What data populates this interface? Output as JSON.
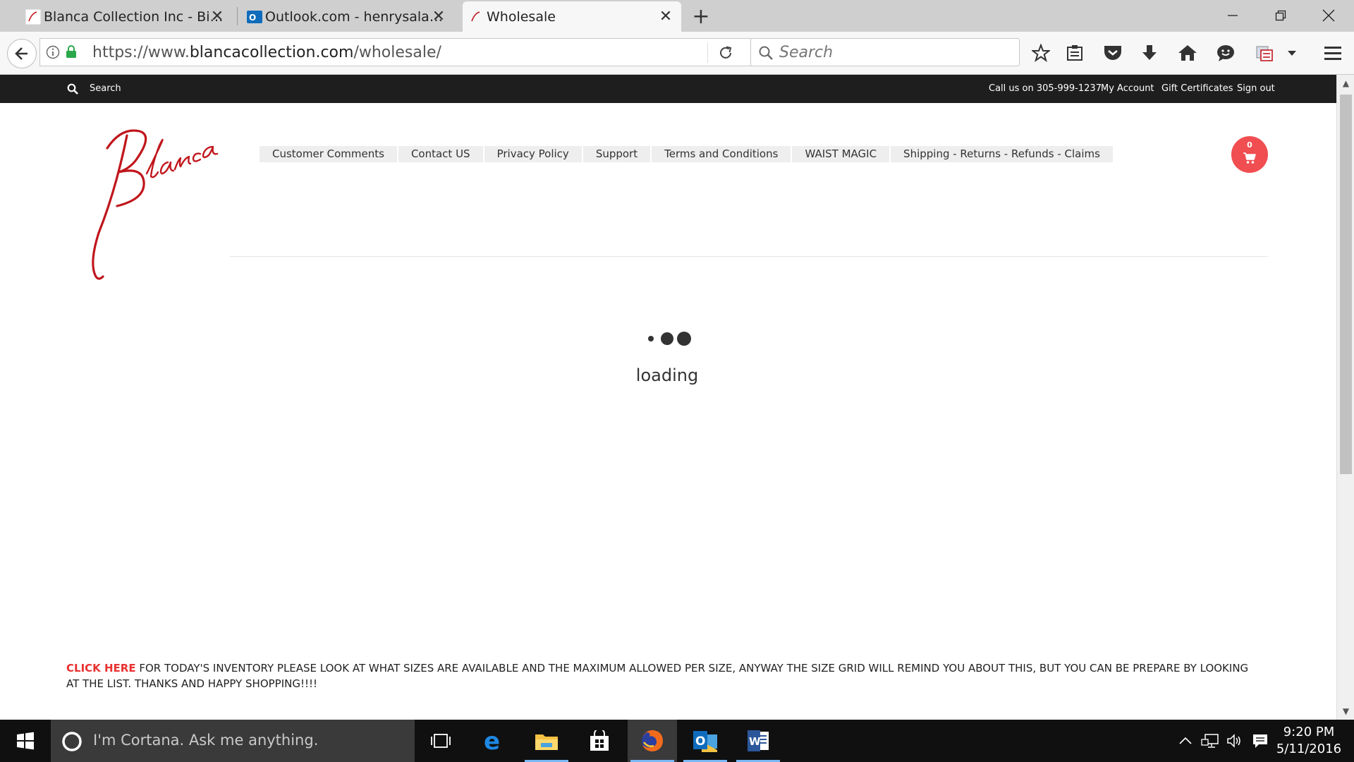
{
  "browser": {
    "tabs": [
      {
        "title": "Blanca Collection Inc - Big...",
        "active": false
      },
      {
        "title": "Outlook.com - henrysalaz...",
        "active": false
      },
      {
        "title": "Wholesale",
        "active": true
      }
    ],
    "url_prefix": "https://www.",
    "url_domain": "blancacollection.com",
    "url_path": "/wholesale/",
    "search_placeholder": "Search"
  },
  "site": {
    "topbar": {
      "search_label": "Search",
      "phone": "Call us on 305-999-1237",
      "my_account": "My Account",
      "gift_certificates": "Gift Certificates",
      "sign_out": "Sign out"
    },
    "menu": [
      "Customer Comments",
      "Contact US",
      "Privacy Policy",
      "Support",
      "Terms and Conditions",
      "WAIST MAGIC",
      "Shipping - Returns - Refunds - Claims"
    ],
    "cart_count": "0",
    "loading_text": "loading",
    "notice_link": "CLICK HERE",
    "notice_text": " FOR TODAY'S INVENTORY PLEASE LOOK AT WHAT SIZES ARE AVAILABLE AND THE MAXIMUM ALLOWED PER SIZE, ANYWAY THE SIZE GRID WILL REMIND YOU ABOUT THIS, BUT YOU CAN BE  PREPARE BY LOOKING AT THE LIST. THANKS AND HAPPY SHOPPING!!!!"
  },
  "taskbar": {
    "cortana_placeholder": "I'm Cortana. Ask me anything.",
    "time": "9:20 PM",
    "date": "5/11/2016"
  },
  "colors": {
    "brand_red": "#c0161c",
    "cart_red": "#f04e51",
    "link_red": "#e8312f"
  }
}
